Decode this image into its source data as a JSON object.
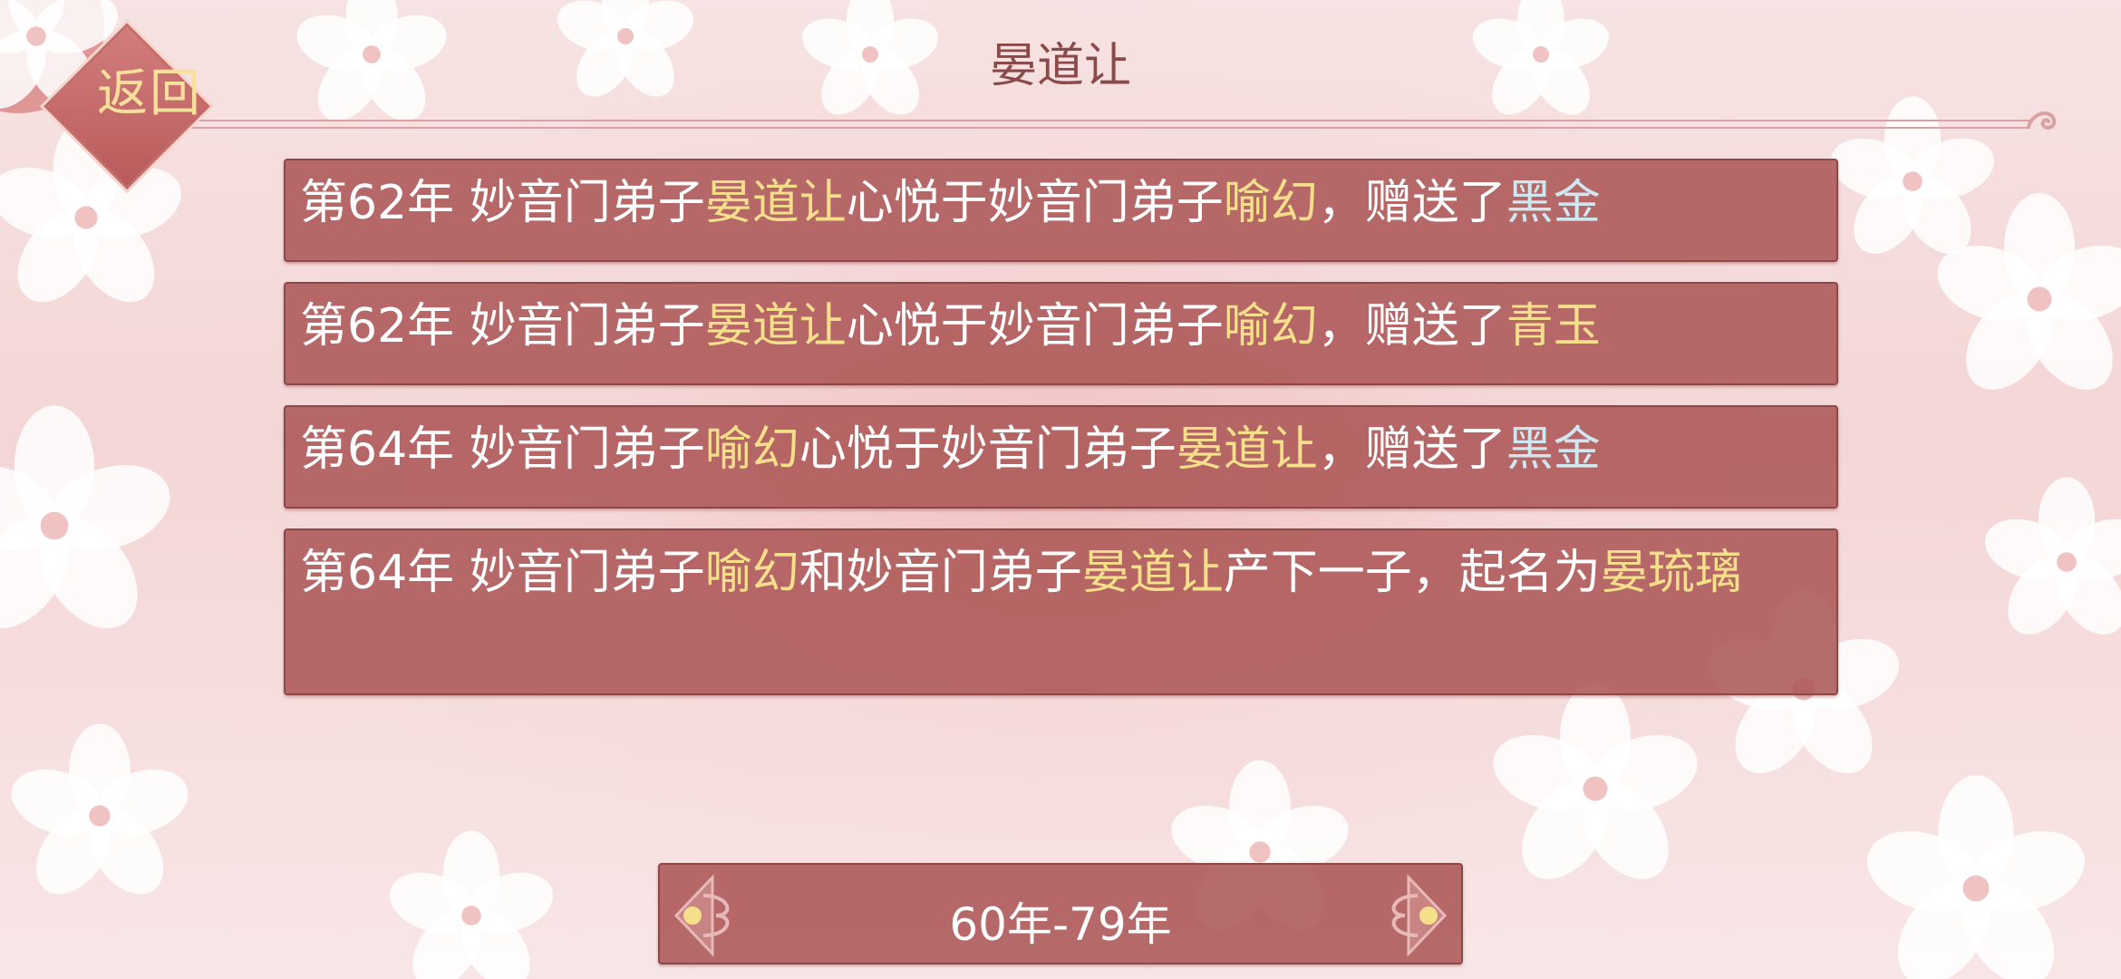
{
  "header": {
    "back_label": "返回",
    "title": "晏道让"
  },
  "events": [
    {
      "segments": [
        {
          "text": "第62年 妙音门弟子",
          "style": "normal"
        },
        {
          "text": "晏道让",
          "style": "name"
        },
        {
          "text": "心悦于妙音门弟子",
          "style": "normal"
        },
        {
          "text": "喻幻",
          "style": "name"
        },
        {
          "text": "，赠送了",
          "style": "normal"
        },
        {
          "text": "黑金",
          "style": "item-black"
        }
      ]
    },
    {
      "segments": [
        {
          "text": "第62年 妙音门弟子",
          "style": "normal"
        },
        {
          "text": "晏道让",
          "style": "name"
        },
        {
          "text": "心悦于妙音门弟子",
          "style": "normal"
        },
        {
          "text": "喻幻",
          "style": "name"
        },
        {
          "text": "，赠送了",
          "style": "normal"
        },
        {
          "text": "青玉",
          "style": "item-jade"
        }
      ]
    },
    {
      "segments": [
        {
          "text": "第64年 妙音门弟子",
          "style": "normal"
        },
        {
          "text": "喻幻",
          "style": "name"
        },
        {
          "text": "心悦于妙音门弟子",
          "style": "normal"
        },
        {
          "text": "晏道让",
          "style": "name"
        },
        {
          "text": "，赠送了",
          "style": "normal"
        },
        {
          "text": "黑金",
          "style": "item-black"
        }
      ]
    },
    {
      "segments": [
        {
          "text": "第64年 妙音门弟子",
          "style": "normal"
        },
        {
          "text": "喻幻",
          "style": "name"
        },
        {
          "text": "和妙音门弟子",
          "style": "normal"
        },
        {
          "text": "晏道让",
          "style": "name"
        },
        {
          "text": "产下一子，起名为",
          "style": "normal"
        },
        {
          "text": "晏琉璃",
          "style": "name"
        }
      ]
    }
  ],
  "pager": {
    "label": "60年-79年"
  },
  "colors": {
    "card_bg": "#ab5454",
    "name_highlight": "#f6df8a",
    "item_black": "#cfe7ef",
    "title_text": "#8b4a4a"
  }
}
